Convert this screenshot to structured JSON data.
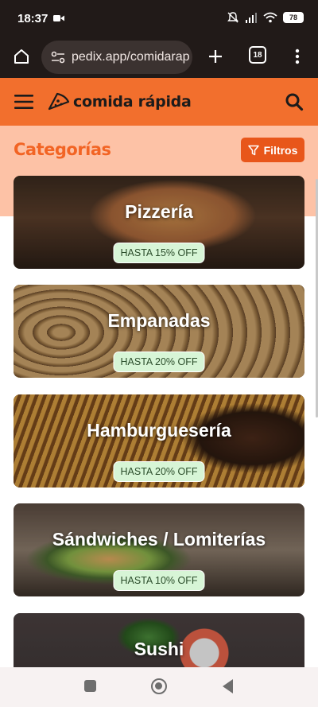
{
  "status": {
    "time": "18:37",
    "battery": "78"
  },
  "browser": {
    "url": "pedix.app/comidarap",
    "tab_count": "18"
  },
  "app": {
    "logo_text": "comida rápida"
  },
  "categories": {
    "title": "Categorías",
    "filter_label": "Filtros",
    "items": [
      {
        "name": "Pizzería",
        "badge": "HASTA 15% OFF"
      },
      {
        "name": "Empanadas",
        "badge": "HASTA 20% OFF"
      },
      {
        "name": "Hamburguesería",
        "badge": "HASTA 20% OFF"
      },
      {
        "name": "Sándwiches / Lomiterías",
        "badge": "HASTA 10% OFF"
      },
      {
        "name": "Sushi",
        "badge": ""
      }
    ]
  },
  "colors": {
    "brand_orange": "#f26f2d",
    "band_peach": "#fdc2a6",
    "filter_button": "#e8561a",
    "badge_green": "#d7f5d6",
    "status_bar": "#211a18"
  },
  "icons": {
    "home": "home-icon",
    "site_settings": "tune-icon",
    "new_tab": "plus-icon",
    "menu": "hamburger-icon",
    "search": "search-icon",
    "filter": "funnel-icon",
    "logo": "pizza-slice-icon"
  }
}
